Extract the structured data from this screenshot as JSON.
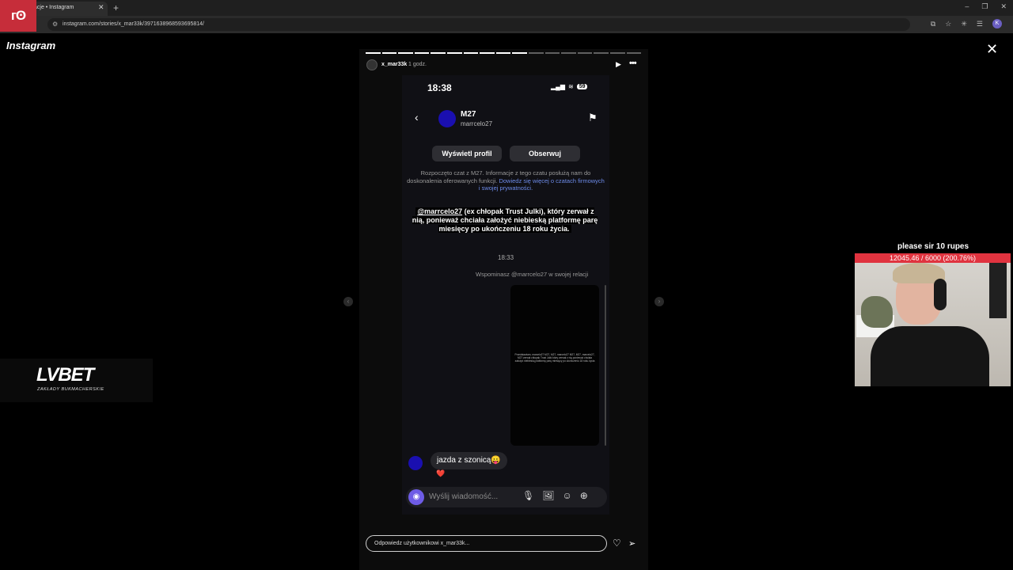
{
  "browser": {
    "tab_title": "acje • Instagram",
    "tab_close": "✕",
    "new_tab": "+",
    "url": "instagram.com/stories/x_mar33k/3971638968593695814/",
    "profile_initial": "K",
    "window_controls": [
      "–",
      "❐",
      "✕"
    ],
    "extension_icons": [
      "⧉",
      "☆",
      "✳",
      "☰"
    ]
  },
  "overlay_logo": "ᴦʘ",
  "instagram": {
    "logo": "Instagram",
    "close": "✕",
    "prev": "‹",
    "next": "›"
  },
  "story": {
    "username": "x_mar33k",
    "time": "1 godz.",
    "progress": {
      "segments": 17,
      "completed": 10
    },
    "play": "▶",
    "more": "•••",
    "reply_placeholder": "Odpowiedz użytkownikowi x_mar33k...",
    "heart": "♡",
    "send": "➢"
  },
  "phone": {
    "clock": "18:38",
    "battery": "59",
    "signal": "▂▄▆",
    "wifi": "≋",
    "back": "‹",
    "flag": "⚑",
    "chat_name": "M27",
    "chat_handle": "marrcelo27",
    "btn_profile": "Wyświetl profil",
    "btn_follow": "Obserwuj",
    "info_text": "Rozpoczęto czat z M27. Informacje z tego czatu posłużą nam do doskonalenia oferowanych funkcji.",
    "info_link": "Dowiedz się więcej o czatach firmowych i swojej prywatności.",
    "caption_mention": "@marrcelo27",
    "caption_rest": " (ex chłopak Trust Julki), który zerwał z nią, ponieważ chciała założyć niebieską platformę parę miesięcy po ukończeniu 18 roku życia.",
    "msg_time": "18:33",
    "mention_notice": "Wspominasz @marrcelo27 w swojej relacji",
    "preview_text": "Przedstawiam, marcelo27 M27, M27, marcelo27 M27, M27, marcelo27, M27 zerwał chłopak Trust Julki który zerwał z nią ponieważ chciała założyć niebieską platformę parę miesięcy po ukończeniu 18 roku życia",
    "message": "jazda z szonicą😛",
    "reaction": "❤️",
    "composer_placeholder": "Wyślij wiadomość...",
    "camera": "◉",
    "composer_icons": [
      "🎙",
      "🖼",
      "☺",
      "⊕"
    ]
  },
  "overlays": {
    "lvbet_logo": "LVBET",
    "lvbet_sub": "ZAKŁADY BUKMACHERSKIE",
    "donation_title": "please sir 10 rupes",
    "donation_progress": "12045.46 / 6000 (200.76%)",
    "donation_fraction": 2.0076
  }
}
